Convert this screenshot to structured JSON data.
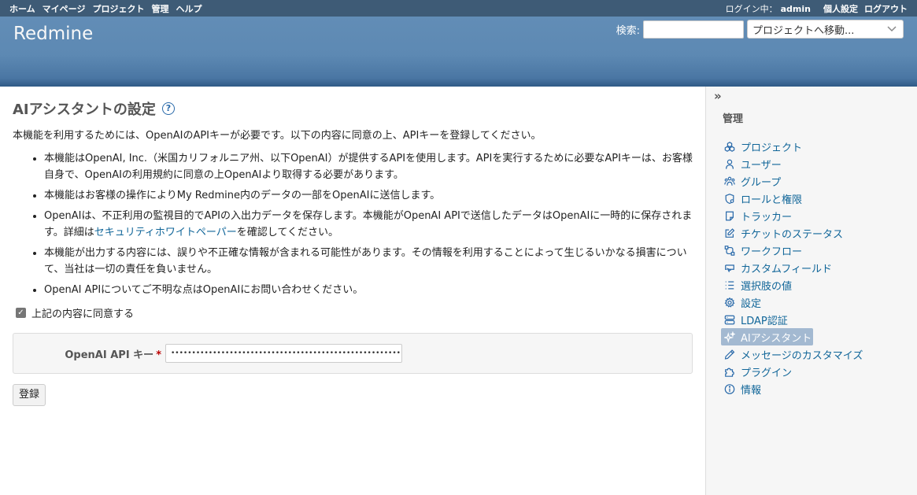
{
  "top_menu": {
    "left": [
      "ホーム",
      "マイページ",
      "プロジェクト",
      "管理",
      "ヘルプ"
    ],
    "logged_in_label": "ログイン中：",
    "user": "admin",
    "my_account": "個人設定",
    "logout": "ログアウト"
  },
  "header": {
    "title": "Redmine",
    "search_label": "検索:",
    "search_value": "",
    "jump_label": "プロジェクトへ移動..."
  },
  "content": {
    "title": "AIアシスタントの設定",
    "help": "?",
    "intro": "本機能を利用するためには、OpenAIのAPIキーが必要です。以下の内容に同意の上、APIキーを登録してください。",
    "terms": [
      "本機能はOpenAI, Inc.（米国カリフォルニア州、以下OpenAI）が提供するAPIを使用します。APIを実行するために必要なAPIキーは、お客様自身で、OpenAIの利用規約に同意の上OpenAIより取得する必要があります。",
      "本機能はお客様の操作によりMy Redmine内のデータの一部をOpenAIに送信します。",
      "OpenAIは、不正利用の監視目的でAPIの入出力データを保存します。本機能がOpenAI APIで送信したデータはOpenAIに一時的に保存されます。詳細は",
      "本機能が出力する内容には、誤りや不正確な情報が含まれる可能性があります。その情報を利用することによって生じるいかなる損害について、当社は一切の責任を負いません。",
      "OpenAI APIについてご不明な点はOpenAIにお問い合わせください。"
    ],
    "terms_link": "セキュリティホワイトペーパー",
    "terms_link_suffix": "を確認してください。",
    "agree_label": "上記の内容に同意する",
    "agree_checked": true,
    "api_key_label": "OpenAI API キー",
    "required_mark": "*",
    "api_key_value": "••••••••••••••••••••••••••••••••••••••••••••••••••••••••••••••••••••",
    "submit": "登録"
  },
  "sidebar": {
    "toggle": "»",
    "heading": "管理",
    "items": [
      {
        "label": "プロジェクト",
        "icon": "projects-icon"
      },
      {
        "label": "ユーザー",
        "icon": "user-icon"
      },
      {
        "label": "グループ",
        "icon": "group-icon"
      },
      {
        "label": "ロールと権限",
        "icon": "role-icon"
      },
      {
        "label": "トラッカー",
        "icon": "tracker-icon"
      },
      {
        "label": "チケットのステータス",
        "icon": "edit-icon"
      },
      {
        "label": "ワークフロー",
        "icon": "workflow-icon"
      },
      {
        "label": "カスタムフィールド",
        "icon": "custom-field-icon"
      },
      {
        "label": "選択肢の値",
        "icon": "list-icon"
      },
      {
        "label": "設定",
        "icon": "gear-icon"
      },
      {
        "label": "LDAP認証",
        "icon": "server-icon"
      },
      {
        "label": "AIアシスタント",
        "icon": "sparkle-icon",
        "selected": true
      },
      {
        "label": "メッセージのカスタマイズ",
        "icon": "pencil-icon"
      },
      {
        "label": "プラグイン",
        "icon": "plugin-icon"
      },
      {
        "label": "情報",
        "icon": "info-icon"
      }
    ]
  }
}
